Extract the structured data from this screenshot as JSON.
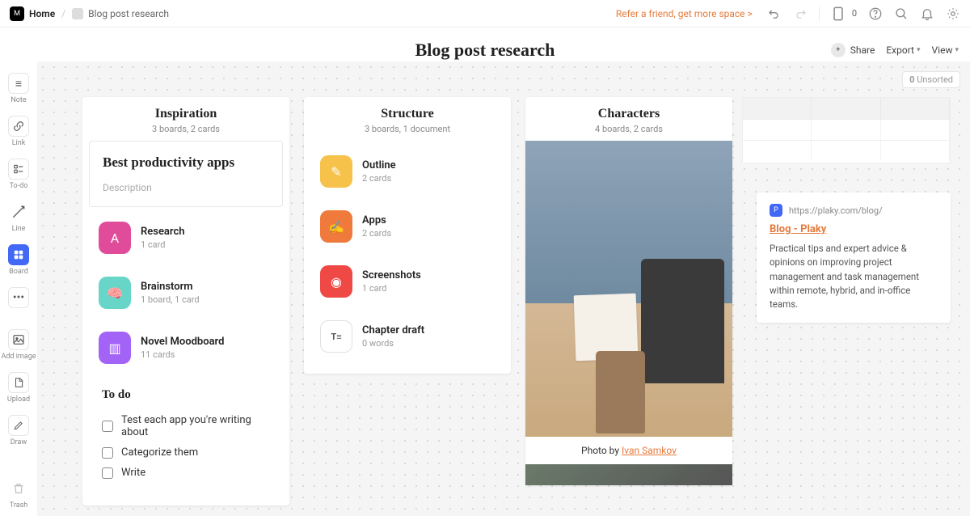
{
  "topbar": {
    "home": "Home",
    "breadcrumb": "Blog post research",
    "refer": "Refer a friend, get more space >",
    "device_count": "0"
  },
  "board": {
    "title": "Blog post research",
    "share": "Share",
    "export": "Export",
    "view": "View",
    "unsorted_count": "0",
    "unsorted_label": "Unsorted"
  },
  "sidebar": {
    "note": "Note",
    "link": "Link",
    "todo": "To-do",
    "line": "Line",
    "board": "Board",
    "add_image": "Add image",
    "upload": "Upload",
    "draw": "Draw",
    "trash": "Trash"
  },
  "columns": {
    "inspiration": {
      "title": "Inspiration",
      "sub": "3 boards, 2 cards",
      "hero_title": "Best productivity apps",
      "hero_desc": "Description",
      "items": [
        {
          "title": "Research",
          "sub": "1 card",
          "bg": "#e04c9a",
          "icon": "A"
        },
        {
          "title": "Brainstorm",
          "sub": "1 board, 1 card",
          "bg": "#67d6c8",
          "icon": "🧠"
        },
        {
          "title": "Novel Moodboard",
          "sub": "11 cards",
          "bg": "#a463f7",
          "icon": "▥"
        }
      ],
      "todo_title": "To do",
      "todos": [
        "Test each app you're writing about",
        "Categorize them",
        "Write"
      ]
    },
    "structure": {
      "title": "Structure",
      "sub": "3 boards, 1 document",
      "items": [
        {
          "title": "Outline",
          "sub": "2 cards",
          "bg": "#f6c24a",
          "icon": "✎"
        },
        {
          "title": "Apps",
          "sub": "2 cards",
          "bg": "#f07a3b",
          "icon": "✍"
        },
        {
          "title": "Screenshots",
          "sub": "1 card",
          "bg": "#ef4946",
          "icon": "◉"
        },
        {
          "title": "Chapter draft",
          "sub": "0 words",
          "bg": "#fff",
          "icon": "T≡",
          "border": true
        }
      ]
    },
    "characters": {
      "title": "Characters",
      "sub": "4 boards, 2 cards",
      "credit_prefix": "Photo by ",
      "credit_link": "Ivan Samkov"
    }
  },
  "link_card": {
    "url": "https://plaky.com/blog/",
    "title": "Blog - Plaky",
    "desc": "Practical tips and expert advice & opinions on improving project management and task management within remote, hybrid, and in-office teams."
  }
}
